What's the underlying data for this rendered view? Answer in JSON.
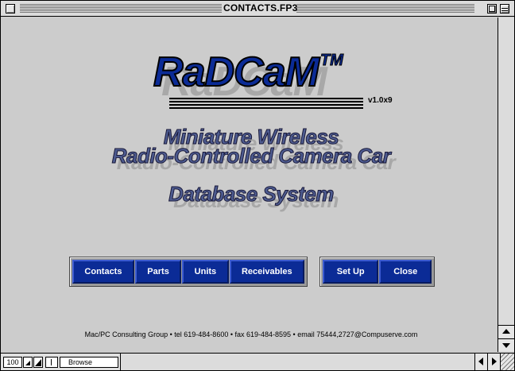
{
  "window": {
    "title": "CONTACTS.FP3"
  },
  "logo": {
    "name": "RaDCaM",
    "tm": "TM",
    "version": "v1.0x9"
  },
  "headlines": {
    "line1": "Miniature Wireless",
    "line2": "Radio-Controlled Camera Car",
    "line3": "Database System"
  },
  "buttons": {
    "contacts": "Contacts",
    "parts": "Parts",
    "units": "Units",
    "receivables": "Receivables",
    "setup": "Set Up",
    "close": "Close"
  },
  "footer": "Mac/PC Consulting Group • tel 619-484-8600 • fax 619-484-8595 • email 75444,2727@Compuserve.com",
  "statusbar": {
    "zoom": "100",
    "mode": "Browse"
  },
  "colors": {
    "accent": "#0b2b96",
    "background": "#cccccc"
  }
}
